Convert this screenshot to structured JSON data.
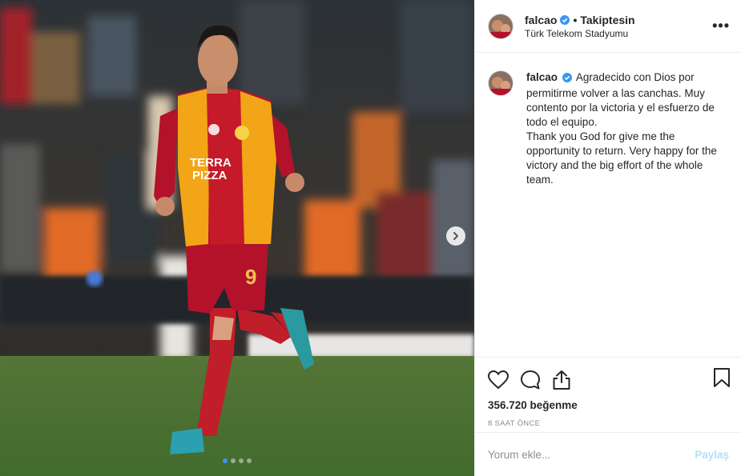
{
  "post": {
    "username": "falcao",
    "follow_status": "Takiptesin",
    "separator": "•",
    "location": "Türk Telekom Stadyumu",
    "more_icon": "more-icon",
    "more_label": "•••"
  },
  "media": {
    "jersey_sponsor_line1": "TERRA",
    "jersey_sponsor_line2": "PIZZA",
    "jersey_number": "9",
    "carousel_total": 4,
    "carousel_active": 1
  },
  "caption": {
    "username": "falcao",
    "text_line1": "Agradecido con Dios por permitirme volver a las canchas. Muy contento por la victoria y el esfuerzo de todo el equipo.",
    "text_line2": "Thank you God for give me the opportunity to return. Very happy for the victory and the big effort of the whole team."
  },
  "stats": {
    "likes": "356.720 beğenme",
    "time_ago": "8 SAAT ÖNCE"
  },
  "comment": {
    "placeholder": "Yorum ekle...",
    "post_label": "Paylaş"
  },
  "colors": {
    "accent": "#3897f0",
    "post_disabled": "#b2dffc",
    "galatasaray_red": "#b3122a",
    "galatasaray_yellow": "#f2a516"
  }
}
